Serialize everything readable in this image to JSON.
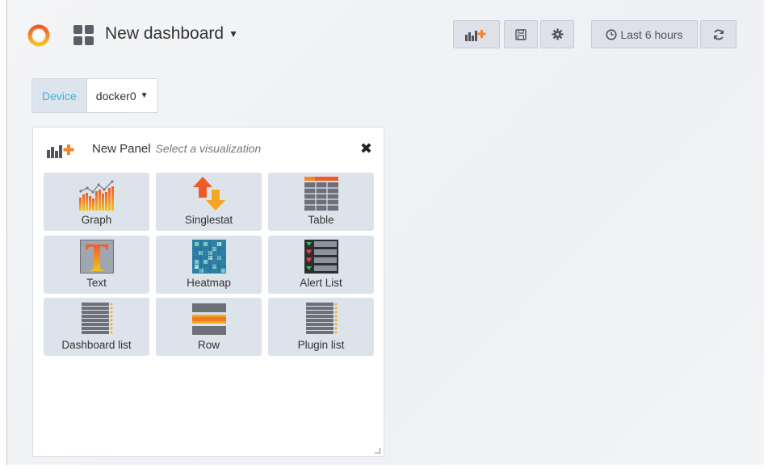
{
  "header": {
    "title": "New dashboard",
    "time_range": "Last 6 hours"
  },
  "variables": [
    {
      "label": "Device",
      "value": "docker0"
    }
  ],
  "panel": {
    "title": "New Panel",
    "subtitle": "Select a visualization",
    "close_icon": "close-icon",
    "visualizations": [
      {
        "label": "Graph",
        "icon": "graph-icon"
      },
      {
        "label": "Singlestat",
        "icon": "singlestat-icon"
      },
      {
        "label": "Table",
        "icon": "table-icon"
      },
      {
        "label": "Text",
        "icon": "text-icon"
      },
      {
        "label": "Heatmap",
        "icon": "heatmap-icon"
      },
      {
        "label": "Alert List",
        "icon": "alert-list-icon"
      },
      {
        "label": "Dashboard list",
        "icon": "dashboard-list-icon"
      },
      {
        "label": "Row",
        "icon": "row-icon"
      },
      {
        "label": "Plugin list",
        "icon": "plugin-list-icon"
      }
    ]
  },
  "colors": {
    "accent": "#33b5e5",
    "orange": "#f5842c",
    "tile_bg": "#dde3ea",
    "button_bg": "#dee2e8"
  }
}
